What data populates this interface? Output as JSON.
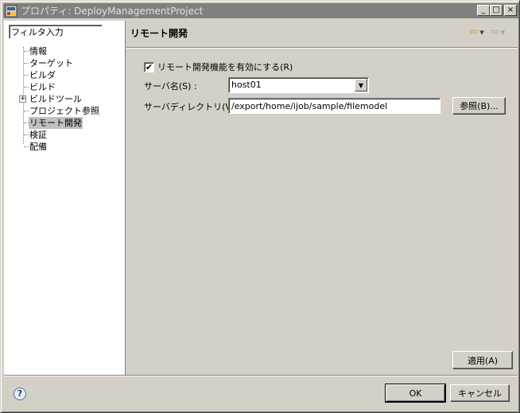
{
  "window": {
    "title": "プロパティ: DeployManagementProject",
    "minimize": "_",
    "maximize": "□",
    "close": "×"
  },
  "sidebar": {
    "filter_placeholder": "フィルタ入力",
    "items": [
      {
        "label": "情報"
      },
      {
        "label": "ターゲット"
      },
      {
        "label": "ビルダ"
      },
      {
        "label": "ビルド"
      },
      {
        "label": "ビルドツール",
        "expandable": true
      },
      {
        "label": "プロジェクト参照"
      },
      {
        "label": "リモート開発",
        "selected": true
      },
      {
        "label": "検証"
      },
      {
        "label": "配備"
      }
    ]
  },
  "page": {
    "title": "リモート開発",
    "enable_checkbox": {
      "label": "リモート開発機能を有効にする(R)",
      "checked": true
    },
    "server_name": {
      "label": "サーバ名(S) :",
      "value": "host01"
    },
    "server_dir": {
      "label": "サーバディレクトリ(V) :",
      "value": "/export/home/ijob/sample/filemodel"
    },
    "browse_label": "参照(B)...",
    "apply_label": "適用(A)"
  },
  "footer": {
    "help": "?",
    "ok_label": "OK",
    "cancel_label": "キャンセル"
  }
}
